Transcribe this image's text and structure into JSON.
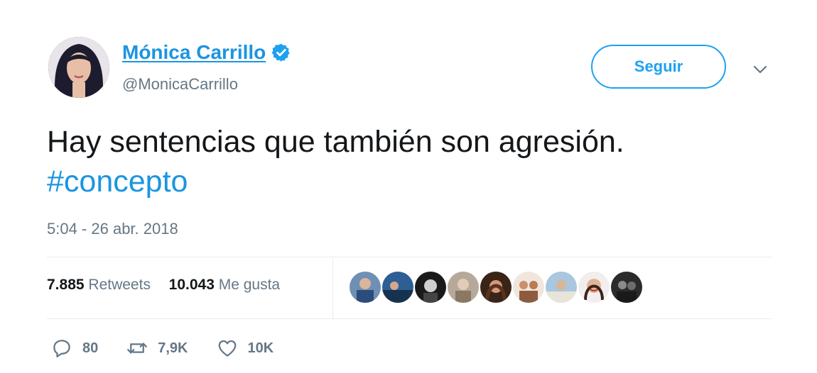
{
  "author": {
    "name": "Mónica Carrillo",
    "handle": "@MonicaCarrillo",
    "verified": true,
    "avatar": "profile-photo"
  },
  "follow_label": "Seguir",
  "tweet": {
    "text": "Hay sentencias que también son agresión.",
    "hashtag": "#concepto"
  },
  "timestamp": "5:04 - 26 abr. 2018",
  "stats": {
    "retweets_count": "7.885",
    "retweets_label": "Retweets",
    "likes_count": "10.043",
    "likes_label": "Me gusta"
  },
  "actions": {
    "replies": "80",
    "retweets": "7,9K",
    "likes": "10K"
  },
  "colors": {
    "accent": "#1da1f2",
    "link": "#1b95e0",
    "secondary_text": "#657786",
    "divider": "#e6ecf0"
  }
}
